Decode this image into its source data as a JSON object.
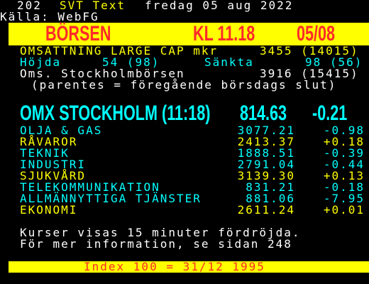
{
  "header": {
    "page_number": "202",
    "channel": "SVT Text",
    "date": "fredag 05 aug 2022",
    "source": "Källa: WebFG"
  },
  "banner": {
    "title": "BÖRSEN",
    "time": "KL 11.18",
    "date_short": "05/08"
  },
  "summary": {
    "turnover_label": "OMSÄTTNING LARGE CAP mkr",
    "turnover_value": "3455 (14015)",
    "high_label": "Höjda",
    "high_value": "54 (98)",
    "low_label": "Sänkta",
    "low_value": "98 (56)",
    "oms_label": "Oms. Stockholmbörsen",
    "oms_value": "3916 (15415)",
    "note": "(parentes = föregående börsdags slut)"
  },
  "index": {
    "name": "OMX STOCKHOLM (11:18)",
    "value": "814.63",
    "change": "-0.21"
  },
  "sectors": [
    {
      "name": "OLJA & GAS",
      "value": "3077.21",
      "change": "-0.98",
      "color": "#00ffff"
    },
    {
      "name": "RÅVAROR",
      "value": "2413.37",
      "change": "+0.18",
      "color": "#ffff00"
    },
    {
      "name": "TEKNIK",
      "value": "1888.51",
      "change": "-0.39",
      "color": "#00ffff"
    },
    {
      "name": "INDUSTRI",
      "value": "2791.04",
      "change": "-0.44",
      "color": "#00ffff"
    },
    {
      "name": "SJUKVÅRD",
      "value": "3139.30",
      "change": "+0.13",
      "color": "#ffff00"
    },
    {
      "name": "TELEKOMMUNIKATION",
      "value": "831.21",
      "change": "-0.18",
      "color": "#00ffff"
    },
    {
      "name": "ALLMÄNNYTTIGA TJÄNSTER",
      "value": "881.06",
      "change": "-7.95",
      "color": "#00ffff"
    },
    {
      "name": "EKONOMI",
      "value": "2611.24",
      "change": "+0.01",
      "color": "#ffff00"
    }
  ],
  "footer": {
    "delay_note": "Kurser visas 15 minuter fördröjda.",
    "info_note": "För mer information, se sidan 248",
    "index_base": "Index 100 = 31/12 1995"
  },
  "colors": {
    "cyan": "#00ffff",
    "yellow": "#ffff00",
    "red": "#ff2a2a",
    "white": "#ffffff"
  }
}
